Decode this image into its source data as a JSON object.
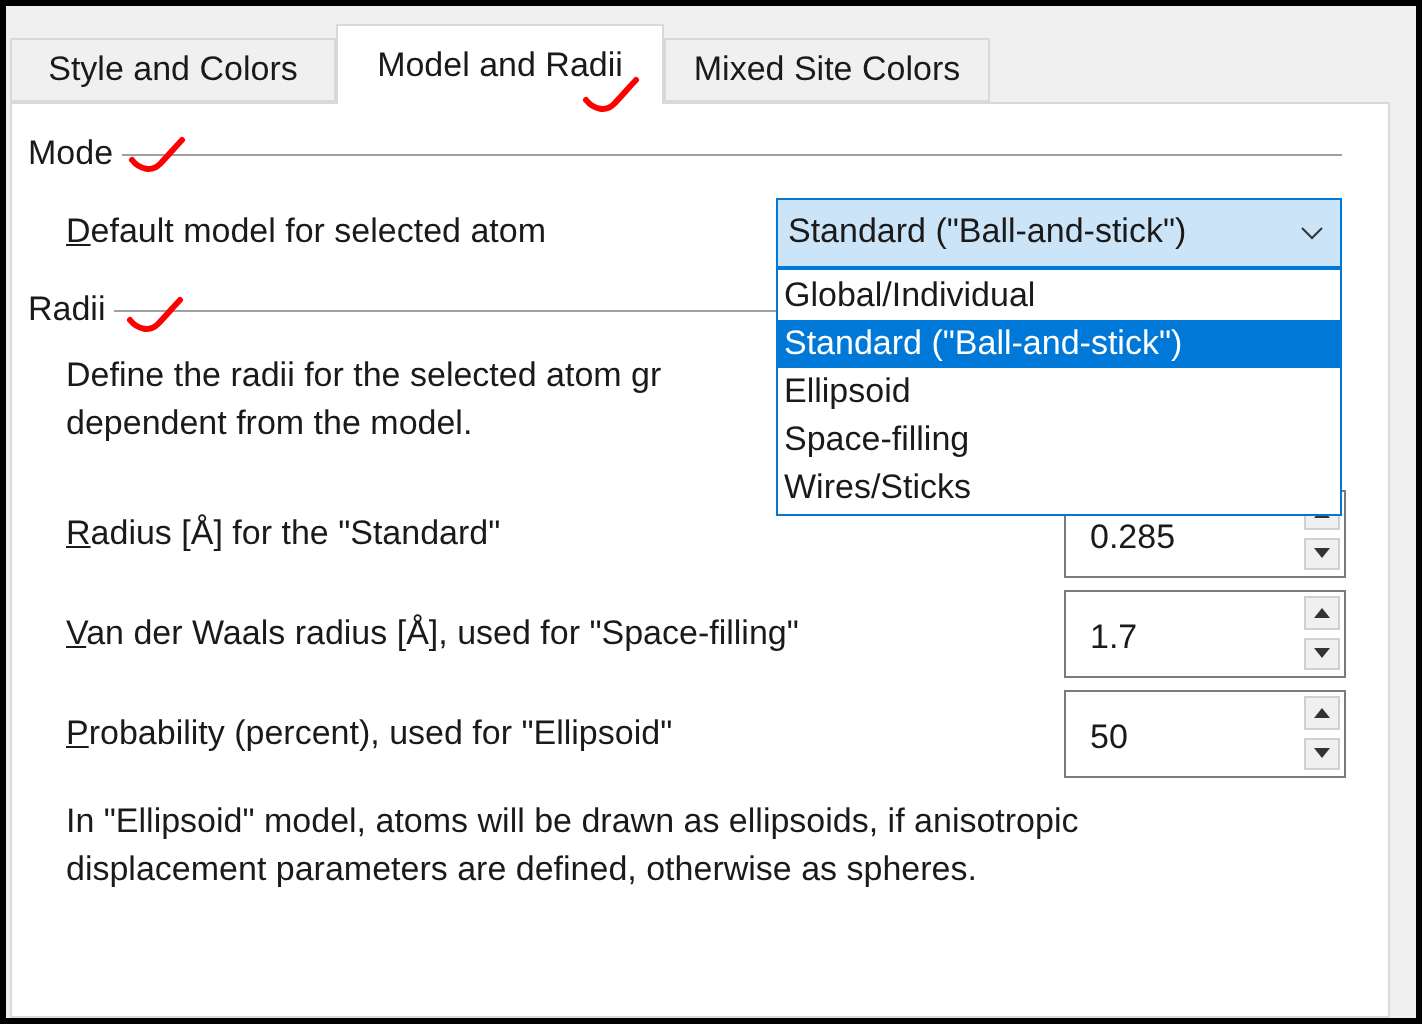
{
  "tabs": [
    {
      "label": "Style and Colors",
      "selected": false
    },
    {
      "label": "Model and Radii",
      "selected": true
    },
    {
      "label": "Mixed Site Colors",
      "selected": false
    }
  ],
  "mode": {
    "heading": "Mode",
    "label": "Default model for selected atom",
    "mnemonic_underlined": true,
    "value": "Standard (\"Ball-and-stick\")",
    "expanded": true,
    "options": [
      {
        "label": "Global/Individual",
        "selected": false
      },
      {
        "label": "Standard (\"Ball-and-stick\")",
        "selected": true
      },
      {
        "label": "Ellipsoid",
        "selected": false
      },
      {
        "label": "Space-filling",
        "selected": false
      },
      {
        "label": "Wires/Sticks",
        "selected": false
      }
    ]
  },
  "radii": {
    "heading": "Radii",
    "description": [
      "Define the radii for the selected atom gr",
      "dependent from the model."
    ],
    "fields": [
      {
        "label": "Radius [Å] for the \"Standard\"",
        "mnemonic_underlined": true,
        "value": "0.285"
      },
      {
        "label": "Van der Waals radius [Å], used for \"Space-filling\"",
        "mnemonic_underlined": true,
        "value": "1.7"
      },
      {
        "label": "Probability (percent), used for \"Ellipsoid\"",
        "mnemonic_underlined": true,
        "value": "50"
      }
    ],
    "note": [
      "In \"Ellipsoid\" model, atoms will be drawn as ellipsoids, if anisotropic",
      "displacement parameters are defined, otherwise as spheres."
    ]
  }
}
